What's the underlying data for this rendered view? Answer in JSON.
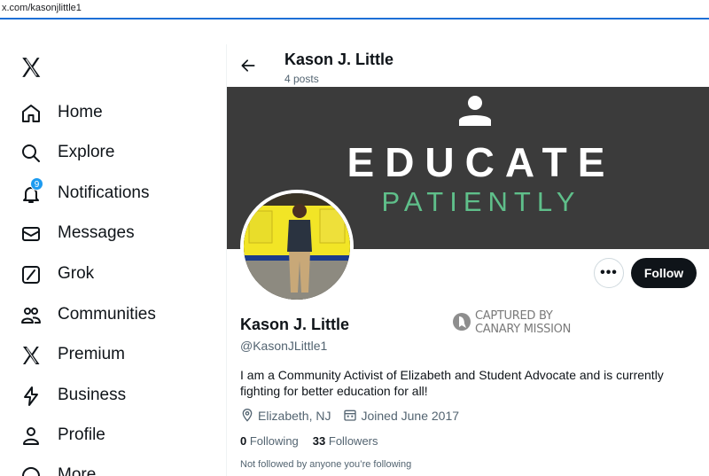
{
  "browser": {
    "url": "x.com/kasonjlittle1"
  },
  "sidebar": {
    "logo": "x-logo-icon",
    "items": [
      {
        "label": "Home",
        "icon": "home-icon"
      },
      {
        "label": "Explore",
        "icon": "search-icon"
      },
      {
        "label": "Notifications",
        "icon": "bell-icon",
        "badge": "9"
      },
      {
        "label": "Messages",
        "icon": "envelope-icon"
      },
      {
        "label": "Grok",
        "icon": "grok-icon"
      },
      {
        "label": "Communities",
        "icon": "people-icon"
      },
      {
        "label": "Premium",
        "icon": "x-logo-icon"
      },
      {
        "label": "Business",
        "icon": "lightning-icon"
      },
      {
        "label": "Profile",
        "icon": "person-icon"
      },
      {
        "label": "More",
        "icon": "more-circle-icon"
      }
    ]
  },
  "header": {
    "name": "Kason J. Little",
    "posts": "4 posts"
  },
  "banner": {
    "line1": "EDUCATE",
    "line2": "PATIENTLY"
  },
  "actions": {
    "more": "•••",
    "follow": "Follow"
  },
  "profile": {
    "name": "Kason J. Little",
    "handle": "@KasonJLittle1",
    "bio": "I am a Community Activist of Elizabeth and Student Advocate and is currently fighting for better education for all!",
    "location": "Elizabeth, NJ",
    "joined": "Joined June 2017",
    "following_count": "0",
    "following_label": "Following",
    "followers_count": "33",
    "followers_label": "Followers",
    "not_followed": "Not followed by anyone you’re following"
  },
  "watermark": {
    "line1": "CAPTURED BY",
    "line2": "CANARY MISSION"
  },
  "colors": {
    "accent": "#1d9bf0",
    "text": "#0f1419",
    "muted": "#536471",
    "banner": "#3b3b3b",
    "banner_green": "#5fbf8a"
  }
}
